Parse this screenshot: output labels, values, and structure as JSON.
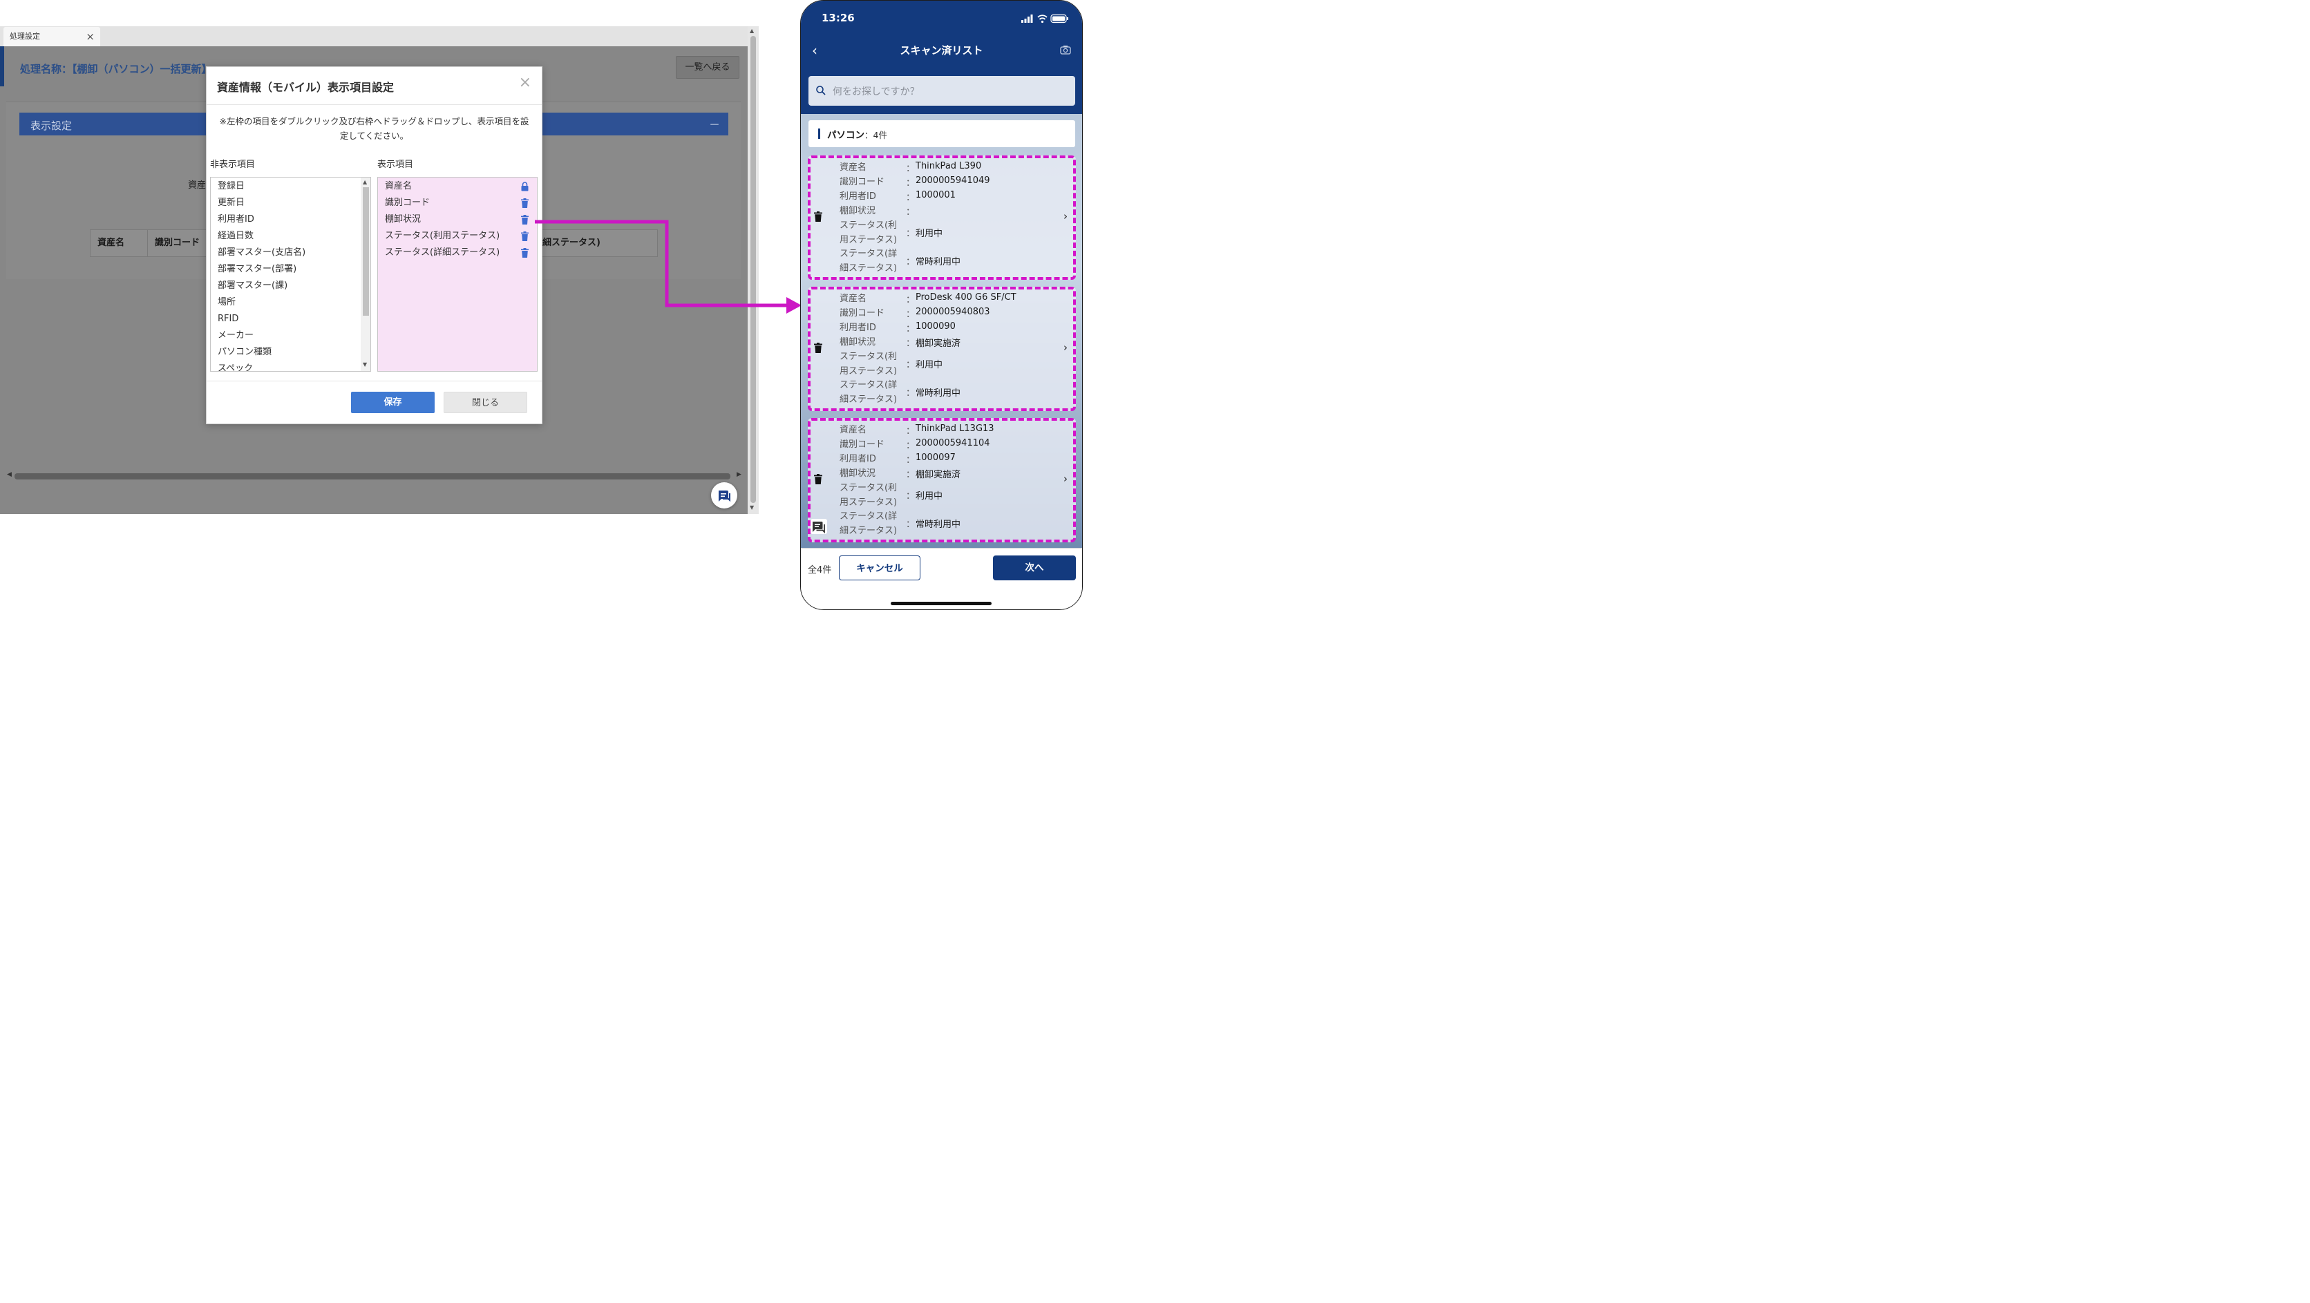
{
  "desktop": {
    "tab_label": "処理設定",
    "tab_close": "×",
    "process_title": "処理名称：【棚卸（パソコン）一括更新】",
    "back_button": "一覧へ戻る",
    "display_settings_header": "表示設定",
    "collapse_symbol": "－",
    "asset_label_fragment": "資産",
    "table_headers": [
      "資産名",
      "識別コード",
      "細ステータス)"
    ]
  },
  "modal": {
    "title": "資産情報（モバイル）表示項目設定",
    "close_symbol": "×",
    "instruction_line1": "※左枠の項目をダブルクリック及び右枠へドラッグ＆ドロップし、表示項目を設",
    "instruction_line2": "定してください。",
    "hidden_label": "非表示項目",
    "shown_label": "表示項目",
    "hidden_items": [
      "登録日",
      "更新日",
      "利用者ID",
      "経過日数",
      "部署マスター(支店名)",
      "部署マスター(部署)",
      "部署マスター(課)",
      "場所",
      "RFID",
      "メーカー",
      "パソコン種類",
      "スペック"
    ],
    "shown_items": [
      {
        "label": "資産名",
        "icon": "lock-icon"
      },
      {
        "label": "識別コード",
        "icon": "trash-icon"
      },
      {
        "label": "棚卸状況",
        "icon": "trash-icon"
      },
      {
        "label": "ステータス(利用ステータス)",
        "icon": "trash-icon"
      },
      {
        "label": "ステータス(詳細ステータス)",
        "icon": "trash-icon"
      }
    ],
    "save_button": "保存",
    "close_button": "閉じる"
  },
  "phone": {
    "time": "13:26",
    "title": "スキャン済リスト",
    "search_placeholder": "何をお探しですか？",
    "category_name": "パソコン",
    "category_count": "：4件",
    "labels": {
      "name": "資産名",
      "code": "識別コード",
      "user": "利用者ID",
      "inventory": "棚卸状況",
      "status_use_1": "ステータス(利",
      "status_use_2": "用ステータス)",
      "status_detail_1": "ステータス(詳",
      "status_detail_2": "細ステータス)",
      "sep": "："
    },
    "cards": [
      {
        "name": "ThinkPad L390",
        "code": "2000005941049",
        "user": "1000001",
        "inventory": "",
        "status_use": "利用中",
        "status_detail": "常時利用中"
      },
      {
        "name": "ProDesk 400 G6 SF/CT",
        "code": "2000005940803",
        "user": "1000090",
        "inventory": "棚卸実施済",
        "status_use": "利用中",
        "status_detail": "常時利用中"
      },
      {
        "name": "ThinkPad L13G13",
        "code": "2000005941104",
        "user": "1000097",
        "inventory": "棚卸実施済",
        "status_use": "利用中",
        "status_detail": "常時利用中"
      }
    ],
    "total_count": "全4件",
    "cancel_button": "キャンセル",
    "next_button": "次へ"
  },
  "colors": {
    "primary_navy": "#133a7e",
    "highlight_magenta": "#d414c9",
    "save_blue": "#3f79d2",
    "shown_bg_pink": "#f8e2f6"
  }
}
